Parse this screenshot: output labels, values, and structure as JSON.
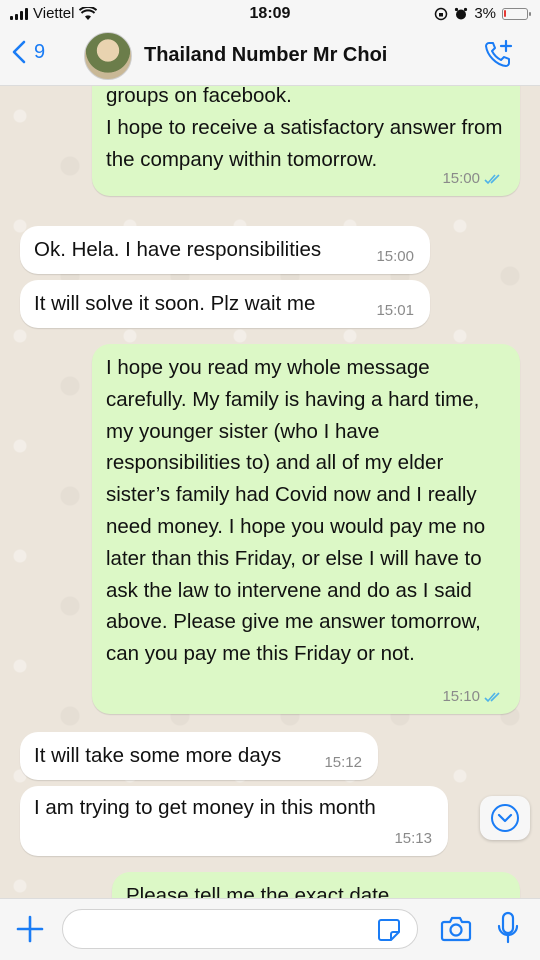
{
  "status_bar": {
    "carrier": "Viettel",
    "time": "18:09",
    "battery_percent": "3%",
    "battery_level": 0.03
  },
  "header": {
    "back_count": "9",
    "contact_name": "Thailand Number Mr Choi"
  },
  "messages": [
    {
      "direction": "out",
      "text": "groups on facebook.\nI hope to receive a satisfactory answer from the company within tomorrow.",
      "time": "15:00"
    },
    {
      "direction": "in",
      "text": "Ok. Hela. I have responsibilities",
      "time": "15:00"
    },
    {
      "direction": "in",
      "text": "It will solve it soon. Plz wait me",
      "time": "15:01"
    },
    {
      "direction": "out",
      "text": "I hope you read my whole message carefully. My family is having a hard time, my younger sister (who I have responsibilities to) and all of my elder sister’s family had Covid now and I really need money. I hope you would pay me no later than this Friday, or else I will have to ask the law to intervene and do as I said above. Please give me answer tomorrow, can you pay me this Friday or not.",
      "time": "15:10"
    },
    {
      "direction": "in",
      "text": "It will take some more days",
      "time": "15:12"
    },
    {
      "direction": "in",
      "text": "I am trying to get money in this month",
      "time": "15:13"
    },
    {
      "direction": "out",
      "text": "Please tell me the exact date",
      "time": ""
    }
  ],
  "input": {
    "placeholder": ""
  },
  "icons": {
    "back": "chevron-left-icon",
    "call": "phone-add-icon",
    "plus": "plus-icon",
    "sticker": "sticker-icon",
    "camera": "camera-icon",
    "mic": "microphone-icon",
    "scroll": "chevron-down-circle-icon"
  },
  "colors": {
    "accent": "#1a7cf5",
    "outgoing_bubble": "#dcf8c6",
    "incoming_bubble": "#ffffff",
    "read_ticks": "#4fb3e8"
  }
}
